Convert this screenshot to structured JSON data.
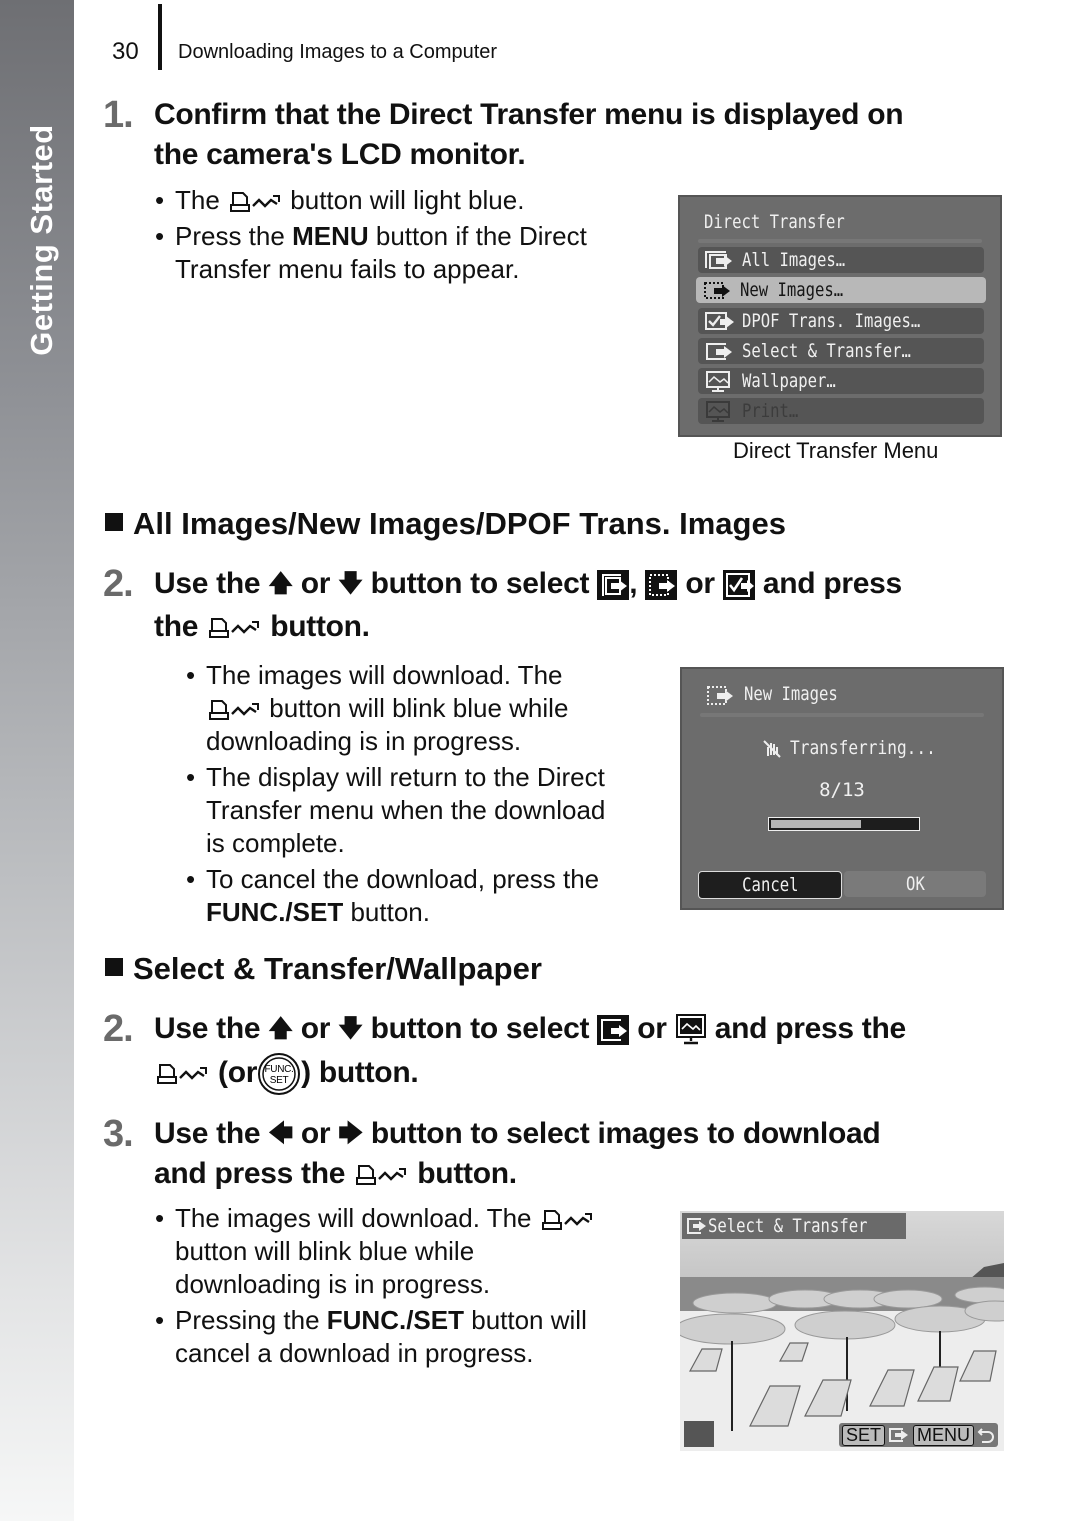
{
  "sidebar": {
    "label": "Getting Started"
  },
  "header": {
    "page_number": "30",
    "title": "Downloading Images to a Computer"
  },
  "step1": {
    "number": "1.",
    "line1": "Confirm that the Direct Transfer menu is displayed on",
    "line2": "the camera's LCD monitor.",
    "bullets": [
      {
        "pre": "The",
        "post": "button will light blue."
      },
      {
        "pre": "Press the",
        "bold": "MENU",
        "post": "button if the Direct",
        "line2": "Transfer menu fails to appear."
      }
    ]
  },
  "lcd_menu": {
    "title": "Direct Transfer",
    "items": [
      {
        "label": "All Images…",
        "icon": "all-images-icon",
        "state": "normal"
      },
      {
        "label": "New Images…",
        "icon": "new-images-icon",
        "state": "selected"
      },
      {
        "label": "DPOF Trans. Images…",
        "icon": "dpof-icon",
        "state": "normal"
      },
      {
        "label": "Select & Transfer…",
        "icon": "select-transfer-icon",
        "state": "normal"
      },
      {
        "label": "Wallpaper…",
        "icon": "wallpaper-icon",
        "state": "normal"
      },
      {
        "label": "Print…",
        "icon": "print-icon",
        "state": "disabled"
      }
    ],
    "caption": "Direct Transfer Menu"
  },
  "section1": {
    "title": "All Images/New Images/DPOF Trans. Images"
  },
  "step2a": {
    "number": "2.",
    "parts": [
      "Use the",
      "or",
      "button to select",
      ",",
      "or",
      "and press"
    ],
    "line2_pre": "the",
    "line2_post": "button.",
    "bullets": [
      {
        "line1": "The images will download. The",
        "line2_post": "button will blink blue while",
        "line3": "downloading is in progress."
      },
      {
        "line1": "The display will return to the Direct",
        "line2": "Transfer menu when the download",
        "line3": "is complete."
      },
      {
        "line1": "To cancel the download, press the",
        "bold": "FUNC./SET",
        "post": "button."
      }
    ]
  },
  "lcd_transfer": {
    "title": "New Images",
    "status": "Transferring...",
    "count": "8/13",
    "progress": 0.615,
    "cancel_label": "Cancel",
    "ok_label": "OK"
  },
  "section2": {
    "title": "Select & Transfer/Wallpaper"
  },
  "step2b": {
    "number": "2.",
    "parts": [
      "Use the",
      "or",
      "button to select",
      "or",
      "and press the"
    ],
    "line2_pre": "(or",
    "line2_post": ") button.",
    "func_label_top": "FUNC.",
    "func_label_bottom": "SET"
  },
  "step3": {
    "number": "3.",
    "parts": [
      "Use the",
      "or",
      "button to select images to download"
    ],
    "line2_pre": "and press the",
    "line2_post": "button.",
    "bullets": [
      {
        "line1": "The images will download. The",
        "line2": "button will blink blue while",
        "line3": "downloading is in progress."
      },
      {
        "pre": "Pressing the",
        "bold": "FUNC./SET",
        "post": "button will",
        "line2": "cancel a download in progress."
      }
    ]
  },
  "lcd_photo": {
    "title": "Select & Transfer",
    "set_label": "SET",
    "menu_label": "MENU"
  }
}
